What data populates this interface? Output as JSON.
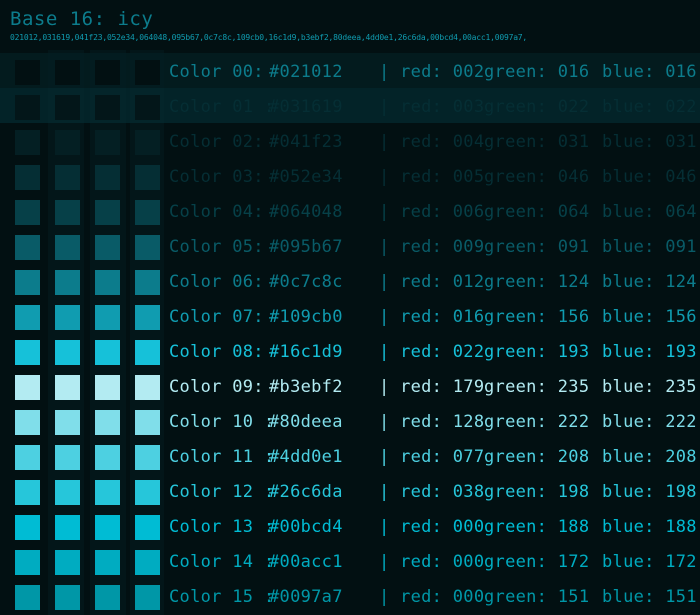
{
  "header": {
    "title": "Base 16: icy",
    "hex_list": "021012,031619,041f23,052e34,064048,095b67,0c7c8c,109cb0,16c1d9,b3ebf2,80deea,4dd0e1,26c6da,00bcd4,00acc1,0097a7,"
  },
  "colors": [
    {
      "name": "Color 00:",
      "hex": "#021012",
      "red": "| red: 002",
      "green": "green: 016",
      "blue": "blue: 016"
    },
    {
      "name": "Color 01 :",
      "hex": "#031619",
      "red": "| red: 003",
      "green": "green: 022",
      "blue": "blue: 022"
    },
    {
      "name": "Color 02:",
      "hex": "#041f23",
      "red": "| red: 004",
      "green": "green: 031",
      "blue": "blue: 031"
    },
    {
      "name": "Color 03:",
      "hex": "#052e34",
      "red": "| red: 005",
      "green": "green: 046",
      "blue": "blue: 046"
    },
    {
      "name": "Color 04:",
      "hex": "#064048",
      "red": "| red: 006",
      "green": "green: 064",
      "blue": "blue: 064"
    },
    {
      "name": "Color 05:",
      "hex": "#095b67",
      "red": "| red: 009",
      "green": "green: 091",
      "blue": "blue: 091"
    },
    {
      "name": "Color 06:",
      "hex": "#0c7c8c",
      "red": "| red: 012",
      "green": "green: 124",
      "blue": "blue: 124"
    },
    {
      "name": "Color 07:",
      "hex": "#109cb0",
      "red": "| red: 016",
      "green": "green: 156",
      "blue": "blue: 156"
    },
    {
      "name": "Color 08:",
      "hex": "#16c1d9",
      "red": "| red: 022",
      "green": "green: 193",
      "blue": "blue: 193"
    },
    {
      "name": "Color 09:",
      "hex": "#b3ebf2",
      "red": "| red: 179",
      "green": "green: 235",
      "blue": "blue: 235"
    },
    {
      "name": "Color 10 :",
      "hex": "#80deea",
      "red": "| red: 128",
      "green": "green: 222",
      "blue": "blue: 222"
    },
    {
      "name": "Color 11  :",
      "hex": "#4dd0e1",
      "red": "| red: 077",
      "green": "green: 208",
      "blue": "blue: 208"
    },
    {
      "name": "Color 12 :",
      "hex": "#26c6da",
      "red": "| red: 038",
      "green": "green: 198",
      "blue": "blue: 198"
    },
    {
      "name": "Color 13 :",
      "hex": "#00bcd4",
      "red": "| red: 000",
      "green": "green: 188",
      "blue": "blue: 188"
    },
    {
      "name": "Color 14 :",
      "hex": "#00acc1",
      "red": "| red: 000",
      "green": "green: 172",
      "blue": "blue: 172"
    },
    {
      "name": "Color 15 :",
      "hex": "#0097a7",
      "red": "| red: 000",
      "green": "green: 151",
      "blue": "blue: 151"
    }
  ],
  "text_colors": [
    "#0c7c8c",
    "#052e34",
    "#052e34",
    "#052e34",
    "#064048",
    "#095b67",
    "#0c7c8c",
    "#109cb0",
    "#16c1d9",
    "#b3ebf2",
    "#80deea",
    "#4dd0e1",
    "#26c6da",
    "#00bcd4",
    "#00acc1",
    "#0097a7"
  ]
}
